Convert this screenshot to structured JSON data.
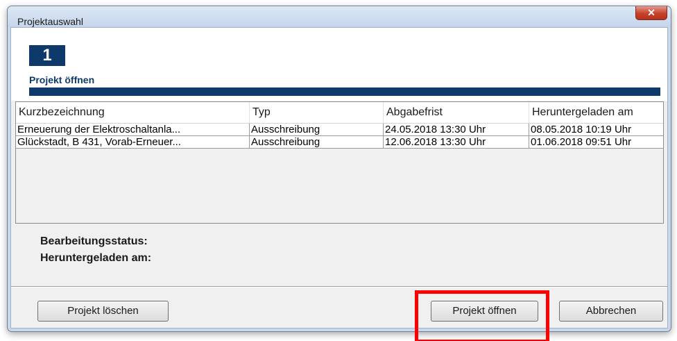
{
  "window": {
    "title": "Projektauswahl",
    "close_label": "✕"
  },
  "wizard": {
    "step_number": "1",
    "step_title": "Projekt öffnen"
  },
  "table": {
    "columns": [
      "Kurzbezeichnung",
      "Typ",
      "Abgabefrist",
      "Heruntergeladen am"
    ],
    "rows": [
      [
        "Erneuerung der Elektroschaltanla...",
        "Ausschreibung",
        "24.05.2018 13:30 Uhr",
        "08.05.2018 10:19 Uhr"
      ],
      [
        "Glückstadt, B 431, Vorab-Erneuer...",
        "Ausschreibung",
        "12.06.2018 13:30 Uhr",
        "01.06.2018 09:51 Uhr"
      ]
    ]
  },
  "details": {
    "status_label": "Bearbeitungsstatus:",
    "downloaded_label": "Heruntergeladen am:"
  },
  "buttons": {
    "delete": "Projekt löschen",
    "open": "Projekt öffnen",
    "cancel": "Abbrechen"
  },
  "colors": {
    "accent": "#0d3a6b",
    "highlight": "#ff0000"
  }
}
